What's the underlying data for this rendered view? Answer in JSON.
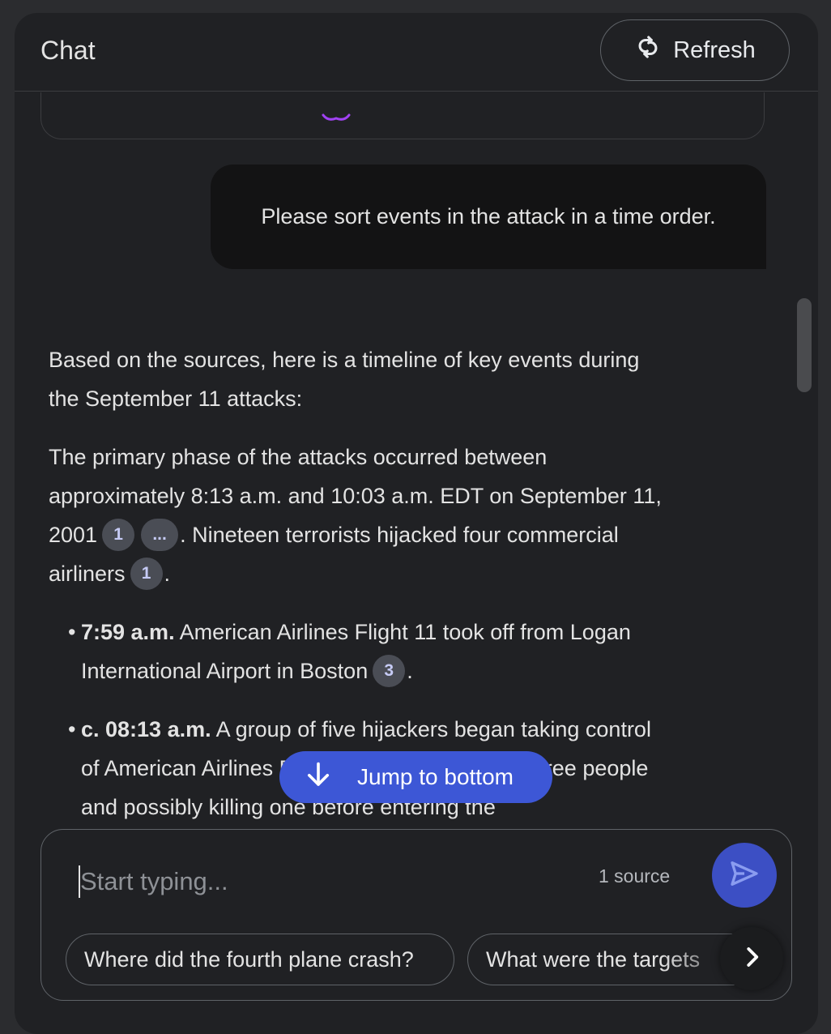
{
  "header": {
    "title": "Chat",
    "refresh_label": "Refresh"
  },
  "conversation": {
    "user_message": "Please sort events in the attack in a time order.",
    "response": {
      "intro": "Based on the sources, here is a timeline of key events during the September 11 attacks:",
      "para2_part1": "The primary phase of the attacks occurred between approximately 8:13 a.m. and 10:03 a.m. EDT on September 11, 2001",
      "para2_cite1": "1",
      "para2_cite2": "...",
      "para2_part2": ". Nineteen terrorists hijacked four commercial airliners",
      "para2_cite3": "1",
      "para2_end": ".",
      "bullets": [
        {
          "time": "7:59 a.m.",
          "text": " American Airlines Flight 11 took off from Logan International Airport in Boston",
          "cite": "3",
          "end": "."
        },
        {
          "time": "c. 08:13 a.m.",
          "text": " A group of five hijackers began taking control of American Airlines Flight 11, injuring at least three people and possibly killing one before entering the"
        }
      ]
    }
  },
  "jump_to_bottom": {
    "label": "Jump to bottom"
  },
  "composer": {
    "placeholder": "Start typing...",
    "source_count": "1 source",
    "suggestions": [
      "Where did the fourth plane crash?",
      "What were the targets"
    ]
  },
  "icons": {
    "refresh": "refresh-icon",
    "arrow_down": "arrow-down-icon",
    "send": "send-icon",
    "chevron_right": "chevron-right-icon"
  },
  "colors": {
    "accent": "#3d57d6",
    "send_button": "#3c4fc4",
    "citation_bg": "#4a4d55",
    "panel_bg": "#202124"
  }
}
